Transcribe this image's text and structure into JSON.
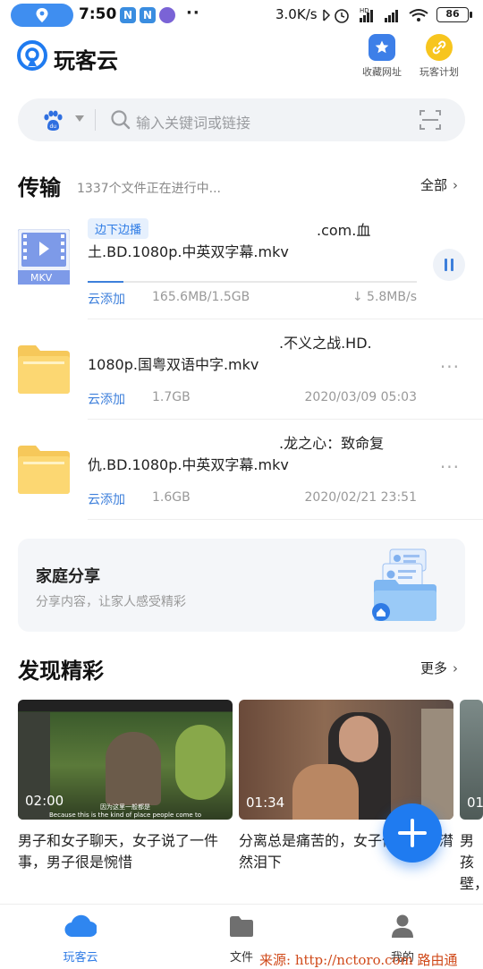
{
  "status_bar": {
    "time": "7:50",
    "app_icons": [
      "N",
      "N",
      ""
    ],
    "more_dots": "··",
    "speed": "3.0K/s",
    "battery": "86"
  },
  "header": {
    "app_title": "玩客云",
    "bookmark_label": "收藏网址",
    "plan_label": "玩客计划"
  },
  "search": {
    "placeholder": "输入关键词或链接"
  },
  "transfer": {
    "title": "传输",
    "subtitle": "1337个文件正在进行中...",
    "all_label": "全部",
    "items": [
      {
        "tag": "边下边播",
        "name_line1": ".com.血",
        "name_line2": "土.BD.1080p.中英双字幕.mkv",
        "source": "云添加",
        "size": "165.6MB/1.5GB",
        "speed": "5.8MB/s",
        "progress": 0.11,
        "file_type": "MKV"
      },
      {
        "name_line1": ".不义之战.HD.",
        "name_line2": "1080p.国粤双语中字.mkv",
        "source": "云添加",
        "size": "1.7GB",
        "date": "2020/03/09 05:03"
      },
      {
        "name_line1": ".龙之心：致命复",
        "name_line2": "仇.BD.1080p.中英双字幕.mkv",
        "source": "云添加",
        "size": "1.6GB",
        "date": "2020/02/21 23:51"
      }
    ]
  },
  "family_share": {
    "title": "家庭分享",
    "subtitle": "分享内容，让家人感受精彩"
  },
  "discover": {
    "title": "发现精彩",
    "more_label": "更多",
    "cards": [
      {
        "duration": "02:00",
        "caption": "男子和女子聊天，女子说了一件事，男子很是惋惜",
        "subtitle_cn": "因为这里一般都是",
        "subtitle_en": "Because this is the kind of place people come to"
      },
      {
        "duration": "01:34",
        "caption": "分离总是痛苦的，女子候，让人潸然泪下"
      },
      {
        "duration": "01",
        "caption": "男孩壁，"
      }
    ]
  },
  "nav": {
    "items": [
      {
        "label": "玩客云",
        "active": true
      },
      {
        "label": "文件",
        "active": false
      },
      {
        "label": "我的",
        "active": false
      }
    ]
  },
  "watermark": "来源: http://nctoro.com 路由通",
  "colors": {
    "accent": "#1f7bf0",
    "link": "#3d7fdb",
    "tag_bg": "#e6f0fd"
  }
}
